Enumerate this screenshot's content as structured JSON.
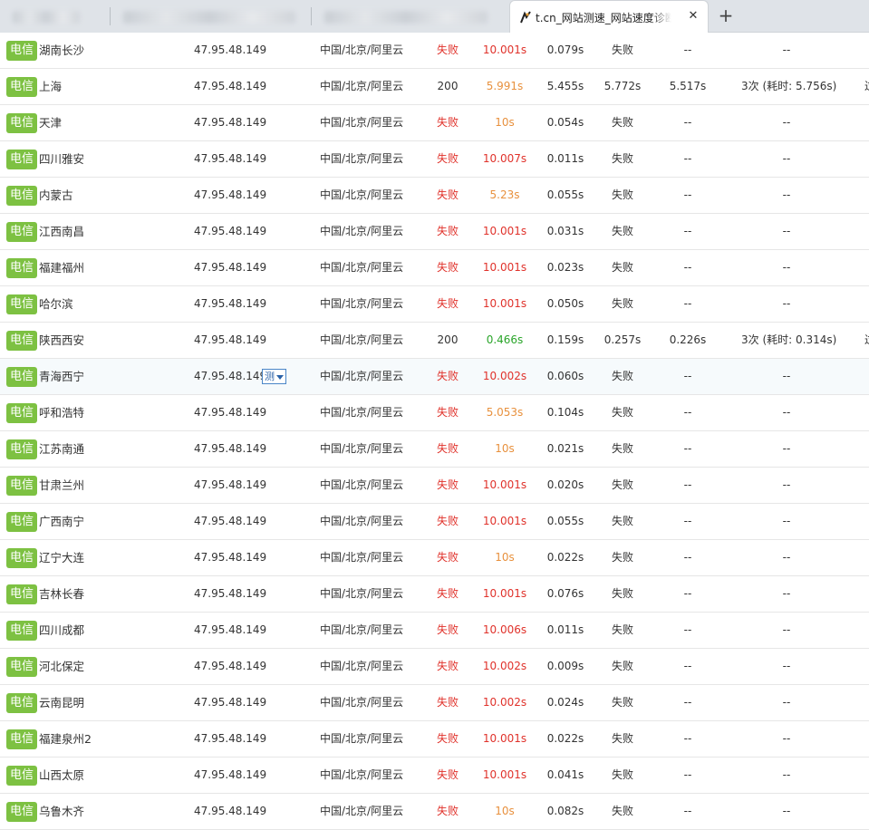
{
  "browser": {
    "active_tab": {
      "title": "t.cn_网站测速_网站速度诊断_"
    },
    "close_symbol": "✕",
    "new_tab_symbol": "+"
  },
  "colors": {
    "badge": "#7dc142",
    "status_fail": "#e0322b",
    "time_slow": "#e8913e",
    "time_fast": "#2aa52a",
    "row_border": "#e6e6e6"
  },
  "results": [
    {
      "isp": "电信",
      "node": "湖南长沙",
      "ip": "47.95.48.149",
      "location": "中国/北京/阿里云",
      "code": "失败",
      "total": "10.001s",
      "total_color": "red",
      "dns": "0.079s",
      "connect": "失败",
      "download": "--",
      "redirect": "--"
    },
    {
      "isp": "电信",
      "node": "上海",
      "ip": "47.95.48.149",
      "location": "中国/北京/阿里云",
      "code": "200",
      "total": "5.991s",
      "total_color": "orange",
      "dns": "5.455s",
      "connect": "5.772s",
      "download": "5.517s",
      "redirect": "3次 (耗时: 5.756s)",
      "edge": "过"
    },
    {
      "isp": "电信",
      "node": "天津",
      "ip": "47.95.48.149",
      "location": "中国/北京/阿里云",
      "code": "失败",
      "total": "10s",
      "total_color": "orange",
      "dns": "0.054s",
      "connect": "失败",
      "download": "--",
      "redirect": "--"
    },
    {
      "isp": "电信",
      "node": "四川雅安",
      "ip": "47.95.48.149",
      "location": "中国/北京/阿里云",
      "code": "失败",
      "total": "10.007s",
      "total_color": "red",
      "dns": "0.011s",
      "connect": "失败",
      "download": "--",
      "redirect": "--"
    },
    {
      "isp": "电信",
      "node": "内蒙古",
      "ip": "47.95.48.149",
      "location": "中国/北京/阿里云",
      "code": "失败",
      "total": "5.23s",
      "total_color": "orange",
      "dns": "0.055s",
      "connect": "失败",
      "download": "--",
      "redirect": "--"
    },
    {
      "isp": "电信",
      "node": "江西南昌",
      "ip": "47.95.48.149",
      "location": "中国/北京/阿里云",
      "code": "失败",
      "total": "10.001s",
      "total_color": "red",
      "dns": "0.031s",
      "connect": "失败",
      "download": "--",
      "redirect": "--"
    },
    {
      "isp": "电信",
      "node": "福建福州",
      "ip": "47.95.48.149",
      "location": "中国/北京/阿里云",
      "code": "失败",
      "total": "10.001s",
      "total_color": "red",
      "dns": "0.023s",
      "connect": "失败",
      "download": "--",
      "redirect": "--"
    },
    {
      "isp": "电信",
      "node": "哈尔滨",
      "ip": "47.95.48.149",
      "location": "中国/北京/阿里云",
      "code": "失败",
      "total": "10.001s",
      "total_color": "red",
      "dns": "0.050s",
      "connect": "失败",
      "download": "--",
      "redirect": "--"
    },
    {
      "isp": "电信",
      "node": "陕西西安",
      "ip": "47.95.48.149",
      "location": "中国/北京/阿里云",
      "code": "200",
      "total": "0.466s",
      "total_color": "green",
      "dns": "0.159s",
      "connect": "0.257s",
      "download": "0.226s",
      "redirect": "3次 (耗时: 0.314s)",
      "edge": "过"
    },
    {
      "isp": "电信",
      "node": "青海西宁",
      "ip": "47.95.48.149",
      "location": "中国/北京/阿里云",
      "code": "失败",
      "total": "10.002s",
      "total_color": "red",
      "dns": "0.060s",
      "connect": "失败",
      "download": "--",
      "redirect": "--",
      "test_button": "测",
      "highlight": true
    },
    {
      "isp": "电信",
      "node": "呼和浩特",
      "ip": "47.95.48.149",
      "location": "中国/北京/阿里云",
      "code": "失败",
      "total": "5.053s",
      "total_color": "orange",
      "dns": "0.104s",
      "connect": "失败",
      "download": "--",
      "redirect": "--"
    },
    {
      "isp": "电信",
      "node": "江苏南通",
      "ip": "47.95.48.149",
      "location": "中国/北京/阿里云",
      "code": "失败",
      "total": "10s",
      "total_color": "orange",
      "dns": "0.021s",
      "connect": "失败",
      "download": "--",
      "redirect": "--"
    },
    {
      "isp": "电信",
      "node": "甘肃兰州",
      "ip": "47.95.48.149",
      "location": "中国/北京/阿里云",
      "code": "失败",
      "total": "10.001s",
      "total_color": "red",
      "dns": "0.020s",
      "connect": "失败",
      "download": "--",
      "redirect": "--"
    },
    {
      "isp": "电信",
      "node": "广西南宁",
      "ip": "47.95.48.149",
      "location": "中国/北京/阿里云",
      "code": "失败",
      "total": "10.001s",
      "total_color": "red",
      "dns": "0.055s",
      "connect": "失败",
      "download": "--",
      "redirect": "--"
    },
    {
      "isp": "电信",
      "node": "辽宁大连",
      "ip": "47.95.48.149",
      "location": "中国/北京/阿里云",
      "code": "失败",
      "total": "10s",
      "total_color": "orange",
      "dns": "0.022s",
      "connect": "失败",
      "download": "--",
      "redirect": "--"
    },
    {
      "isp": "电信",
      "node": "吉林长春",
      "ip": "47.95.48.149",
      "location": "中国/北京/阿里云",
      "code": "失败",
      "total": "10.001s",
      "total_color": "red",
      "dns": "0.076s",
      "connect": "失败",
      "download": "--",
      "redirect": "--"
    },
    {
      "isp": "电信",
      "node": "四川成都",
      "ip": "47.95.48.149",
      "location": "中国/北京/阿里云",
      "code": "失败",
      "total": "10.006s",
      "total_color": "red",
      "dns": "0.011s",
      "connect": "失败",
      "download": "--",
      "redirect": "--"
    },
    {
      "isp": "电信",
      "node": "河北保定",
      "ip": "47.95.48.149",
      "location": "中国/北京/阿里云",
      "code": "失败",
      "total": "10.002s",
      "total_color": "red",
      "dns": "0.009s",
      "connect": "失败",
      "download": "--",
      "redirect": "--"
    },
    {
      "isp": "电信",
      "node": "云南昆明",
      "ip": "47.95.48.149",
      "location": "中国/北京/阿里云",
      "code": "失败",
      "total": "10.002s",
      "total_color": "red",
      "dns": "0.024s",
      "connect": "失败",
      "download": "--",
      "redirect": "--"
    },
    {
      "isp": "电信",
      "node": "福建泉州2",
      "ip": "47.95.48.149",
      "location": "中国/北京/阿里云",
      "code": "失败",
      "total": "10.001s",
      "total_color": "red",
      "dns": "0.022s",
      "connect": "失败",
      "download": "--",
      "redirect": "--"
    },
    {
      "isp": "电信",
      "node": "山西太原",
      "ip": "47.95.48.149",
      "location": "中国/北京/阿里云",
      "code": "失败",
      "total": "10.001s",
      "total_color": "red",
      "dns": "0.041s",
      "connect": "失败",
      "download": "--",
      "redirect": "--"
    },
    {
      "isp": "电信",
      "node": "乌鲁木齐",
      "ip": "47.95.48.149",
      "location": "中国/北京/阿里云",
      "code": "失败",
      "total": "10s",
      "total_color": "orange",
      "dns": "0.082s",
      "connect": "失败",
      "download": "--",
      "redirect": "--"
    }
  ]
}
